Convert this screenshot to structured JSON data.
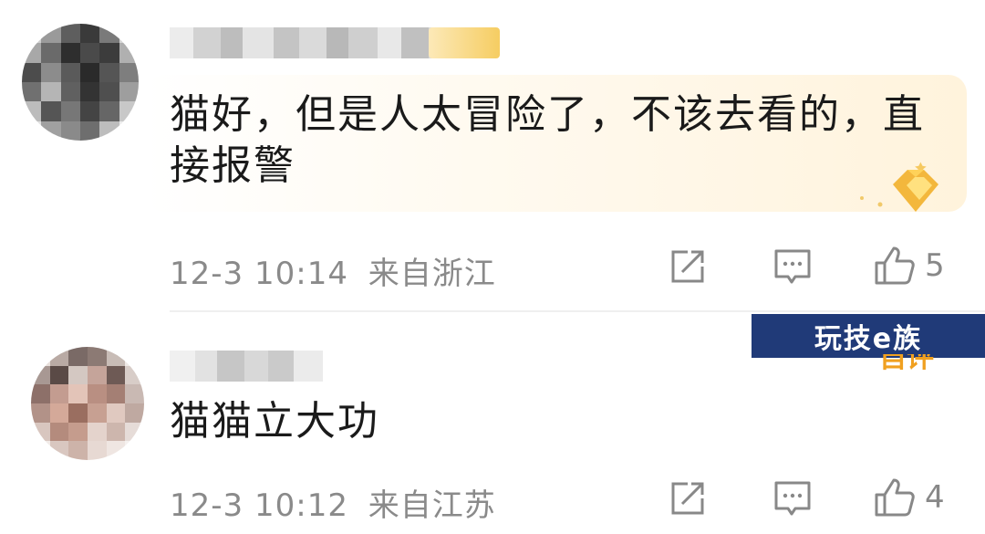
{
  "comments": [
    {
      "text": "猫好，但是人太冒险了，不该去看的，直接报警",
      "time": "12-3 10:14",
      "location": "来自浙江",
      "likes": "5",
      "icons": {
        "share": "share-icon",
        "reply": "comment-icon",
        "like": "thumbs-up-icon",
        "medal": "medal-badge-icon"
      }
    },
    {
      "text": "猫猫立大功",
      "time": "12-3 10:12",
      "location": "来自江苏",
      "likes": "4",
      "icons": {
        "share": "share-icon",
        "reply": "comment-icon",
        "like": "thumbs-up-icon"
      }
    }
  ],
  "watermark": {
    "text": "玩技e族"
  },
  "overlay_partial_text": "自评",
  "colors": {
    "meta_text": "#8a8a8a",
    "watermark_bg": "#203a78",
    "badge_gold": "#f7c85a"
  }
}
